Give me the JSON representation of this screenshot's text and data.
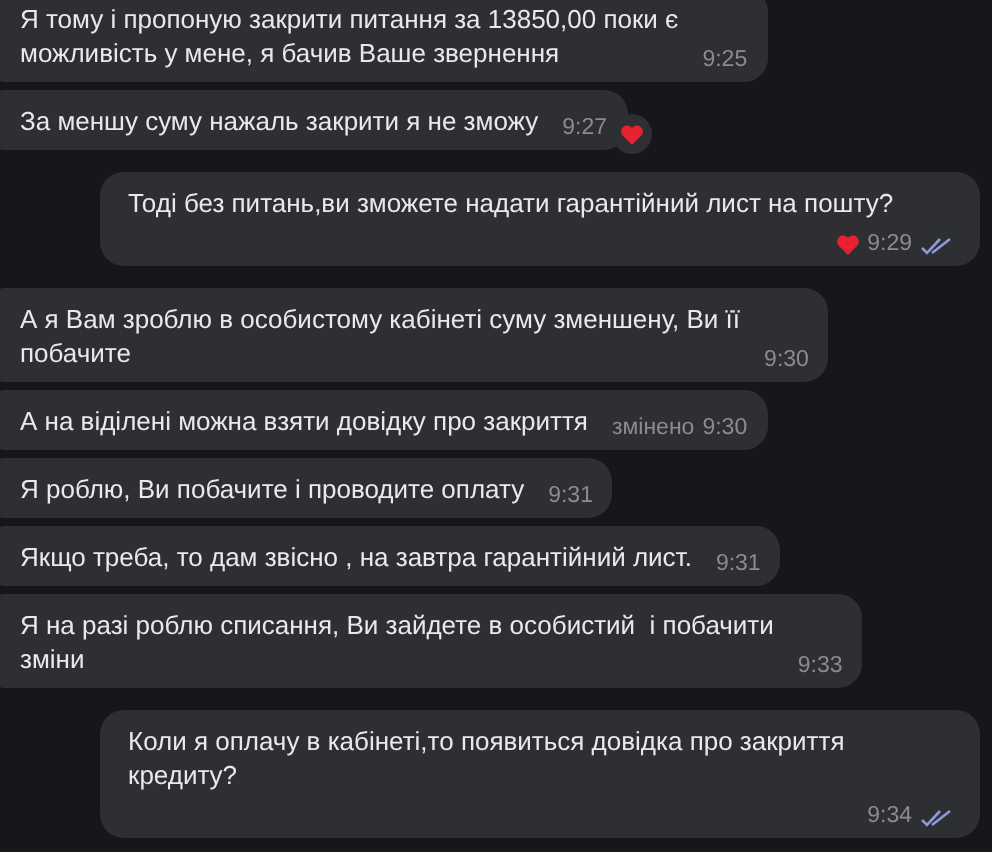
{
  "messages": [
    {
      "kind": "incoming",
      "text": "Я тому і пропоную закрити питання за 13850,00 поки є\nможливість у мене, я бачив Ваше звернення",
      "time": "9:25"
    },
    {
      "kind": "incoming",
      "text": "За меншу суму нажаль закрити я не зможу",
      "time": "9:27",
      "liked": true
    },
    {
      "kind": "outgoing",
      "text": "Тоді без питань,ви зможете надати гарантійний лист на пошту?",
      "time": "9:29",
      "liked": true,
      "read": true
    },
    {
      "kind": "incoming",
      "text": "А я Вам зроблю в особистому кабінеті суму зменшену, Ви її\nпобачите",
      "time": "9:30"
    },
    {
      "kind": "incoming",
      "text": "А на віділені можна взяти довідку про закриття",
      "edited": "змінено",
      "time": "9:30"
    },
    {
      "kind": "incoming",
      "text": "Я роблю, Ви побачите і проводите оплату",
      "time": "9:31"
    },
    {
      "kind": "incoming",
      "text": "Якщо треба, то дам звісно , на завтра гарантійний лист.",
      "time": "9:31"
    },
    {
      "kind": "incoming",
      "text": "Я на разі роблю списання, Ви зайдете в особистий  і побачити\nзміни",
      "time": "9:33"
    },
    {
      "kind": "outgoing",
      "text": "Коли я оплачу в кабінеті,то появиться довідка про закриття\nкредиту?",
      "time": "9:34",
      "read": true
    }
  ]
}
